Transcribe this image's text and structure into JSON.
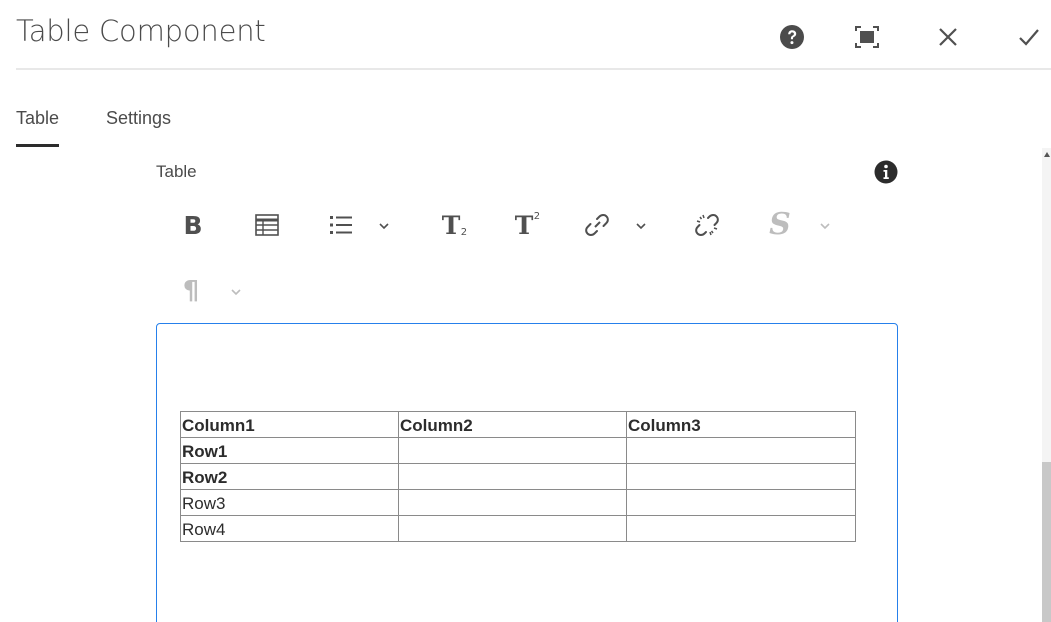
{
  "dialog": {
    "title": "Table Component"
  },
  "header_actions": [
    {
      "name": "help-icon"
    },
    {
      "name": "fullscreen-icon"
    },
    {
      "name": "close-icon"
    },
    {
      "name": "done-checkmark-icon"
    }
  ],
  "tabs": [
    {
      "label": "Table",
      "active": true
    },
    {
      "label": "Settings",
      "active": false
    }
  ],
  "field": {
    "label": "Table"
  },
  "toolbar": {
    "buttons": [
      "bold-icon",
      "table-icon",
      "list-icon",
      "subscript-icon",
      "superscript-icon",
      "link-icon",
      "unlink-icon",
      "strikethrough-s-icon",
      "paragraph-icon"
    ],
    "bold_glyph": "B",
    "subscript_glyph": "T",
    "superscript_glyph": "T",
    "sub_mark": "2",
    "sup_mark": "2",
    "style_glyph": "S",
    "paragraph_glyph": "¶"
  },
  "table": {
    "rows": [
      [
        {
          "text": "Column1",
          "bold": true
        },
        {
          "text": "Column2",
          "bold": true
        },
        {
          "text": "Column3",
          "bold": true
        }
      ],
      [
        {
          "text": "Row1",
          "bold": true
        },
        {
          "text": "",
          "bold": false
        },
        {
          "text": "",
          "bold": false
        }
      ],
      [
        {
          "text": "Row2",
          "bold": true
        },
        {
          "text": "",
          "bold": false
        },
        {
          "text": "",
          "bold": false
        }
      ],
      [
        {
          "text": "Row3",
          "bold": false
        },
        {
          "text": "",
          "bold": false
        },
        {
          "text": "",
          "bold": false
        }
      ],
      [
        {
          "text": "Row4",
          "bold": false
        },
        {
          "text": "",
          "bold": false
        },
        {
          "text": "",
          "bold": false
        }
      ]
    ]
  },
  "colors": {
    "accent_border": "#2680eb",
    "text": "#4b4b4b",
    "icon": "#505050",
    "disabled_icon": "#bdbdbd"
  }
}
